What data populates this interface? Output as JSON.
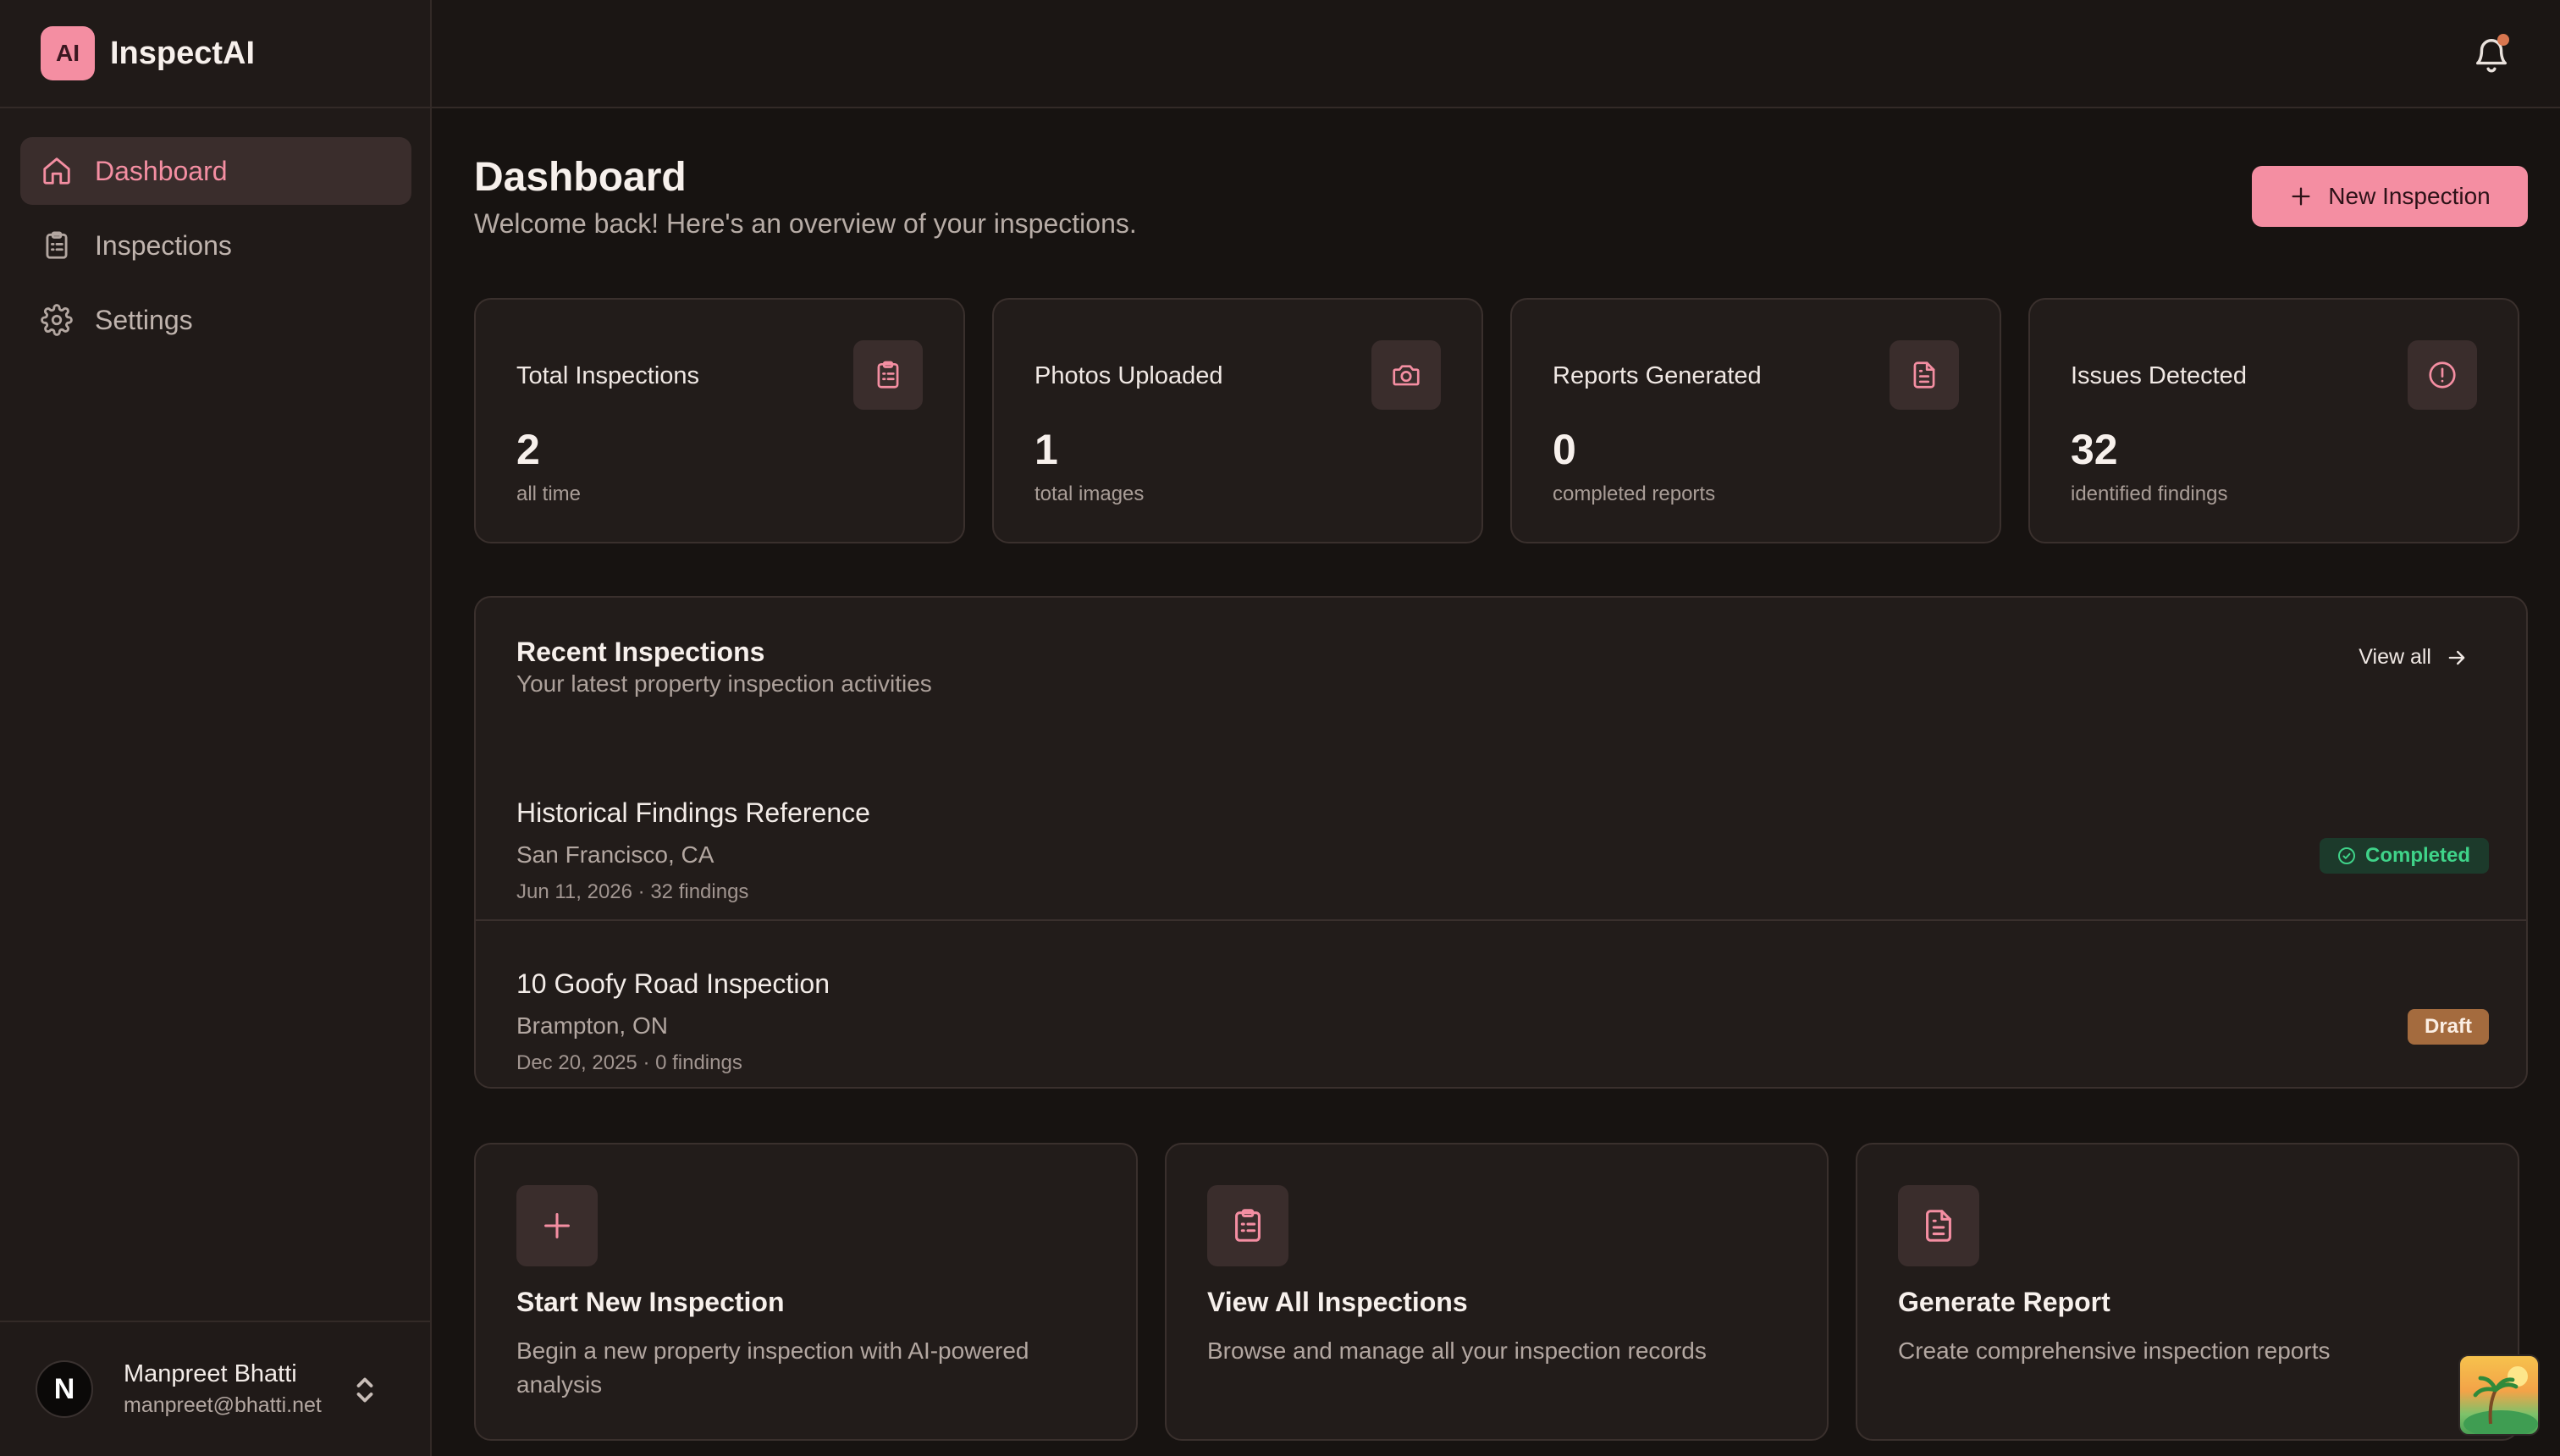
{
  "brand": {
    "logo_text": "AI",
    "name": "InspectAI"
  },
  "sidebar": {
    "items": [
      {
        "label": "Dashboard",
        "icon": "home-icon",
        "active": true
      },
      {
        "label": "Inspections",
        "icon": "clipboard-icon",
        "active": false
      },
      {
        "label": "Settings",
        "icon": "gear-icon",
        "active": false
      }
    ]
  },
  "user": {
    "initial": "N",
    "name": "Manpreet Bhatti",
    "email": "manpreet@bhatti.net"
  },
  "topbar": {
    "notifications_icon": "bell-icon",
    "has_unread": true
  },
  "page": {
    "title": "Dashboard",
    "subtitle": "Welcome back! Here's an overview of your inspections.",
    "new_button": "New Inspection"
  },
  "stats": [
    {
      "label": "Total Inspections",
      "value": "2",
      "note": "all time",
      "icon": "clipboard-icon"
    },
    {
      "label": "Photos Uploaded",
      "value": "1",
      "note": "total images",
      "icon": "camera-icon"
    },
    {
      "label": "Reports Generated",
      "value": "0",
      "note": "completed reports",
      "icon": "document-icon"
    },
    {
      "label": "Issues Detected",
      "value": "32",
      "note": "identified findings",
      "icon": "alert-circle-icon"
    }
  ],
  "recent": {
    "title": "Recent Inspections",
    "subtitle": "Your latest property inspection activities",
    "view_all": "View all",
    "rows": [
      {
        "title": "Historical Findings Reference",
        "location": "San Francisco, CA",
        "meta": "Jun 11, 2026 · 32 findings",
        "status": "Completed"
      },
      {
        "title": "10 Goofy Road Inspection",
        "location": "Brampton, ON",
        "meta": "Dec 20, 2025 · 0 findings",
        "status": "Draft"
      }
    ]
  },
  "actions": [
    {
      "title": "Start New Inspection",
      "desc": "Begin a new property inspection with AI-powered analysis",
      "icon": "plus-icon"
    },
    {
      "title": "View All Inspections",
      "desc": "Browse and manage all your inspection records",
      "icon": "clipboard-icon"
    },
    {
      "title": "Generate Report",
      "desc": "Create comprehensive inspection reports",
      "icon": "document-icon"
    }
  ],
  "colors": {
    "accent": "#f48ea2",
    "success": "#3fd389",
    "draft": "#a46b3e",
    "background": "#171311"
  }
}
